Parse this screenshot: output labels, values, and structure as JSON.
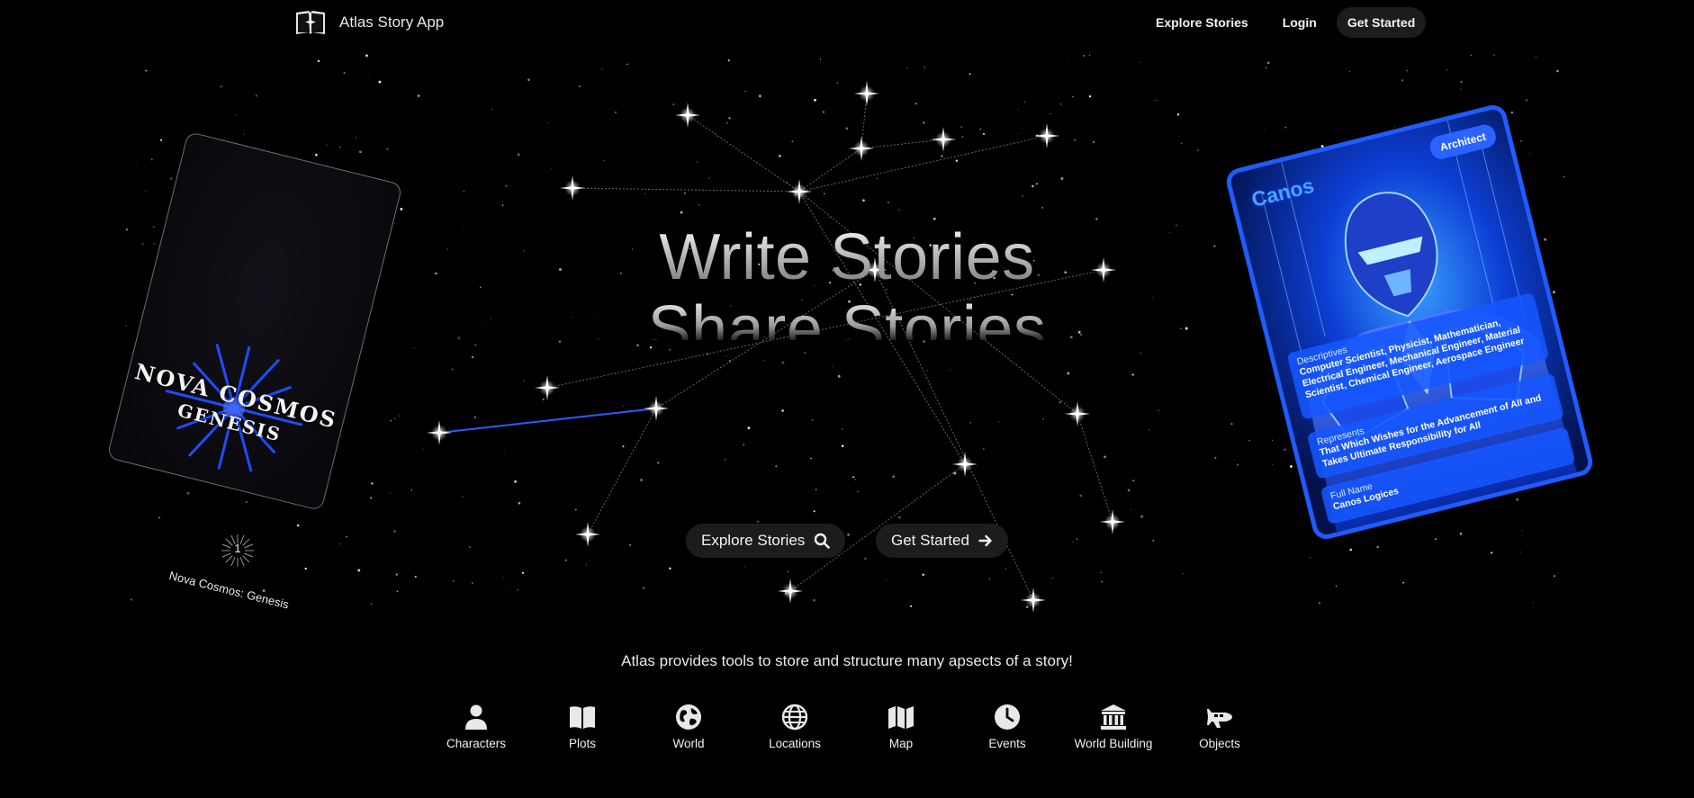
{
  "header": {
    "brand_name": "Atlas Story App",
    "logo_icon": "open-book-star-icon",
    "nav": {
      "explore": "Explore Stories",
      "login": "Login",
      "get_started": "Get Started"
    }
  },
  "hero": {
    "title_line_1": "Write Stories",
    "title_line_2": "Share Stories",
    "buttons": {
      "explore": {
        "label": "Explore Stories",
        "icon": "search-icon"
      },
      "get_started": {
        "label": "Get Started",
        "icon": "arrow-right-icon"
      }
    }
  },
  "story_card": {
    "cover_title_1": "NOVA COSMOS",
    "cover_title_2": "GENESIS",
    "badge_number": "1",
    "caption": "Nova Cosmos: Genesis"
  },
  "character_card": {
    "name": "Canos",
    "role": "Architect",
    "descriptives_label": "Descriptives",
    "descriptives_value": "Computer Scientist, Physicist, Mathematician, Electrical Engineer, Mechanical Engineer, Material Scientist, Chemical Engineer, Aerospace Engineer",
    "represents_label": "Represents",
    "represents_value": "That Which Wishes for the Advancement of All and Takes Ultimate Responsibility for All",
    "full_name_label": "Full Name",
    "full_name_value": "Canos Logices"
  },
  "tagline": "Atlas provides tools to store and structure many apsects of a story!",
  "features": [
    {
      "label": "Characters",
      "icon": "person-icon"
    },
    {
      "label": "Plots",
      "icon": "open-book-icon"
    },
    {
      "label": "World",
      "icon": "globe-icon"
    },
    {
      "label": "Locations",
      "icon": "grid-globe-icon"
    },
    {
      "label": "Map",
      "icon": "map-icon"
    },
    {
      "label": "Events",
      "icon": "clock-icon"
    },
    {
      "label": "World Building",
      "icon": "landmark-icon"
    },
    {
      "label": "Objects",
      "icon": "spaceship-icon"
    }
  ],
  "colors": {
    "background": "#000000",
    "pill": "#1c1c1f",
    "accent_blue": "#1f5cff",
    "constellation_highlight": "#2f5bff"
  }
}
